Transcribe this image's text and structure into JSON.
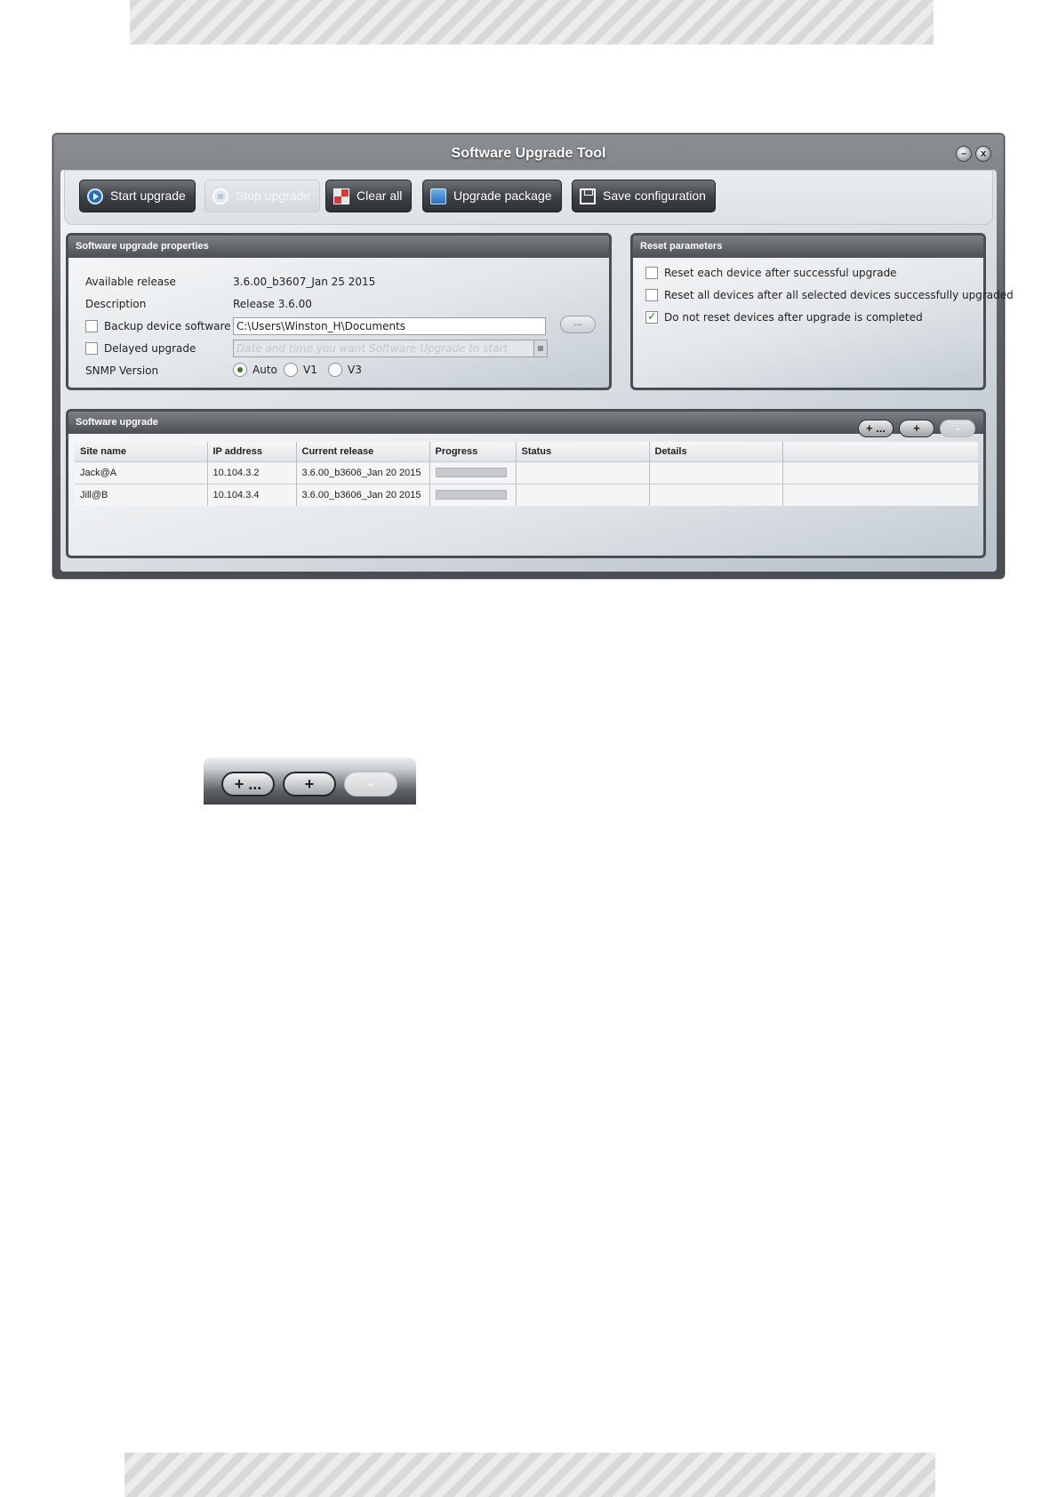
{
  "window": {
    "title": "Software Upgrade Tool",
    "min_symbol": "–",
    "close_symbol": "x"
  },
  "toolbar": {
    "buttons": [
      {
        "label": "Start upgrade",
        "icon": "play-icon"
      },
      {
        "label": "Stop upgrade",
        "icon": "stop-icon"
      },
      {
        "label": "Clear all",
        "icon": "clear-grid-icon"
      },
      {
        "label": "Upgrade package",
        "icon": "package-icon"
      },
      {
        "label": "Save configuration",
        "icon": "save-icon"
      }
    ]
  },
  "properties": {
    "title": "Software upgrade properties",
    "available_release_label": "Available release",
    "available_release_value": "3.6.00_b3607_Jan 25 2015",
    "description_label": "Description",
    "description_value": "Release 3.6.00",
    "backup_label": "Backup device software",
    "backup_checked": false,
    "backup_path": "C:\\Users\\Winston_H\\Documents",
    "browse_label": "...",
    "delayed_label": "Delayed upgrade",
    "delayed_checked": false,
    "delayed_placeholder": "Date and time you want Software Upgrade to start",
    "snmp_label": "SNMP Version",
    "snmp_options": [
      "Auto",
      "V1",
      "V3"
    ],
    "snmp_selected": "Auto"
  },
  "reset": {
    "title": "Reset parameters",
    "options": [
      {
        "label": "Reset each device after successful upgrade",
        "checked": false
      },
      {
        "label": "Reset all devices after all selected devices successfully upgraded",
        "checked": false
      },
      {
        "label": "Do not reset devices after upgrade is completed",
        "checked": true
      }
    ]
  },
  "upgrade": {
    "title": "Software upgrade",
    "header_buttons": [
      "+ ...",
      "+",
      "-"
    ],
    "columns": [
      "Site name",
      "IP address",
      "Current release",
      "Progress",
      "Status",
      "Details",
      ""
    ],
    "rows": [
      {
        "site": "Jack@A",
        "ip": "10.104.3.2",
        "release": "3.6.00_b3606_Jan 20 2015",
        "progress": 0,
        "status": "",
        "details": ""
      },
      {
        "site": "Jill@B",
        "ip": "10.104.3.4",
        "release": "3.6.00_b3606_Jan 20 2015",
        "progress": 0,
        "status": "",
        "details": ""
      }
    ]
  },
  "zoom": {
    "buttons": [
      "+ ...",
      "+",
      "-"
    ]
  }
}
